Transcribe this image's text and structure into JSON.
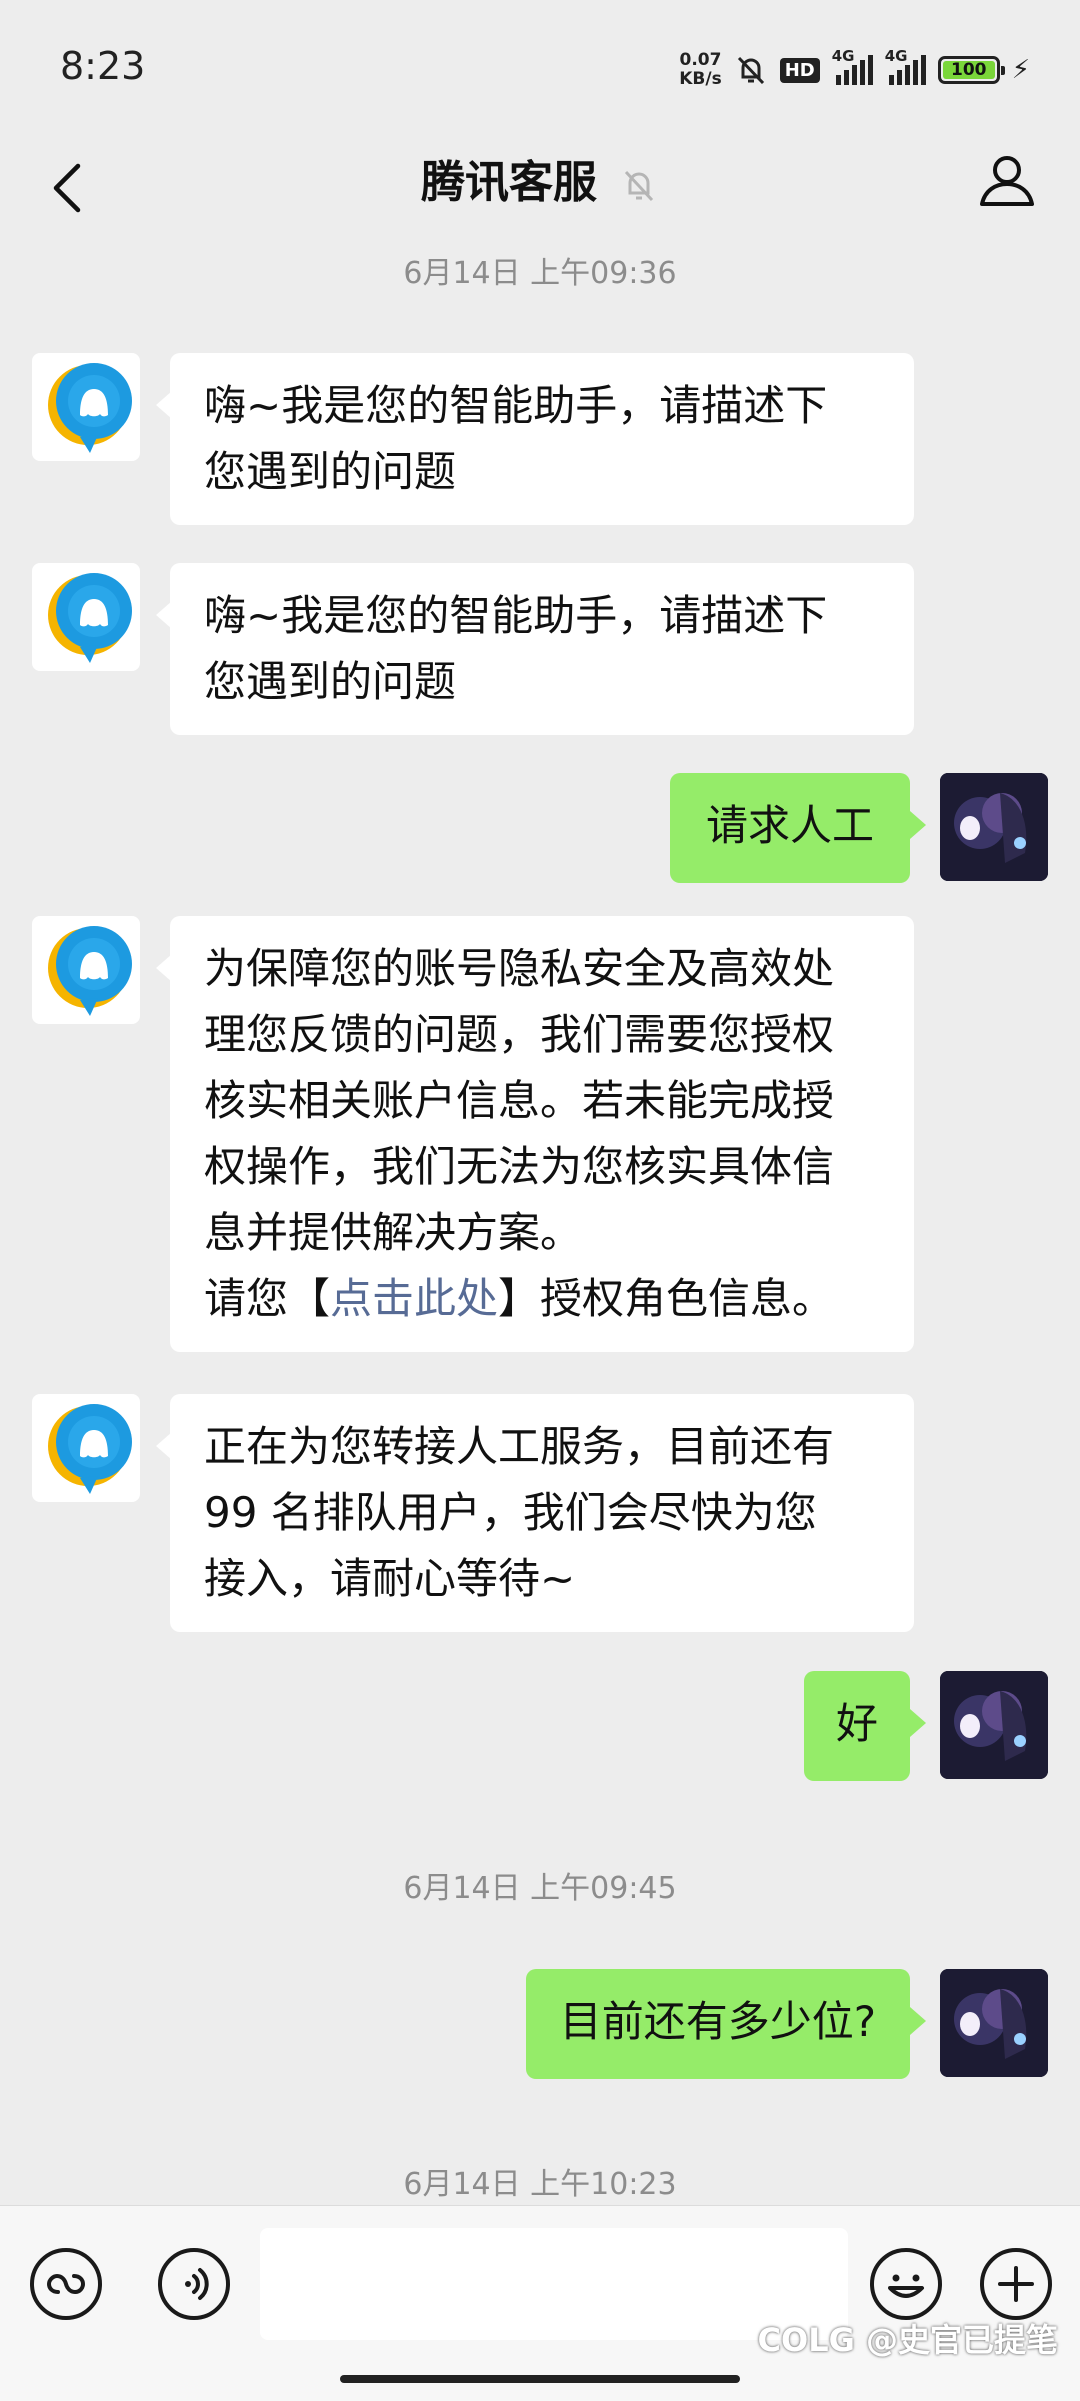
{
  "status_bar": {
    "time": "8:23",
    "net_speed_value": "0.07",
    "net_speed_unit": "KB/s",
    "hd_label": "HD",
    "sim1_label": "4G",
    "sim2_label": "4G",
    "battery_level": "100"
  },
  "header": {
    "title": "腾讯客服"
  },
  "messages": {
    "ts1": "6月14日 上午09:36",
    "m1": [
      "嗨~我是您的智能助手，请描述下",
      "您遇到的问题"
    ],
    "m2": [
      "嗨~我是您的智能助手，请描述下",
      "您遇到的问题"
    ],
    "m3": "请求人工",
    "m4": [
      "为保障您的账号隐私安全及高效处",
      "理您反馈的问题，我们需要您授权",
      "核实相关账户信息。若未能完成授",
      "权操作，我们无法为您核实具体信",
      "息并提供解决方案。"
    ],
    "m4_prefix": "请您【",
    "m4_link": "点击此处",
    "m4_suffix": "】授权角色信息。",
    "m5": [
      "正在为您转接人工服务，目前还有",
      "99 名排队用户，我们会尽快为您",
      "接入，请耐心等待~"
    ],
    "m6": "好",
    "ts2": "6月14日 上午09:45",
    "m7": "目前还有多少位?",
    "ts3": "6月14日 上午10:23"
  },
  "input": {
    "value": "",
    "placeholder": ""
  },
  "watermark": "COLG @史官已提笔",
  "colors": {
    "background": "#ededed",
    "bot_bubble": "#ffffff",
    "user_bubble": "#95ec69",
    "link": "#576b95",
    "timestamp": "#8c8c8c"
  }
}
